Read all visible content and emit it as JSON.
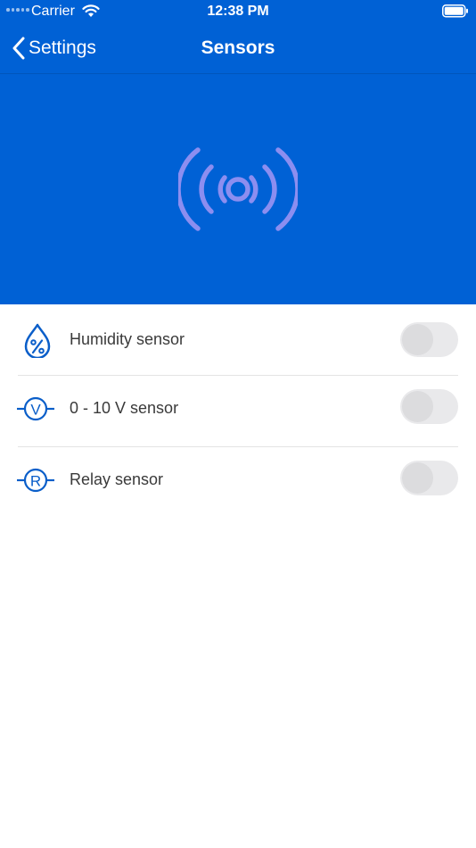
{
  "status_bar": {
    "carrier": "Carrier",
    "time": "12:38 PM"
  },
  "nav": {
    "back_label": "Settings",
    "title": "Sensors"
  },
  "icons": {
    "hero": "broadcast-signal-icon",
    "back": "chevron-left-icon"
  },
  "sensors": [
    {
      "label": "Humidity sensor",
      "icon": "humidity-drop-icon",
      "enabled": false
    },
    {
      "label": "0 - 10 V sensor",
      "icon": "voltage-v-icon",
      "enabled": false
    },
    {
      "label": "Relay sensor",
      "icon": "relay-r-icon",
      "enabled": false
    }
  ],
  "colors": {
    "brand_blue": "#0061d5",
    "hero_icon": "#8c8ef0",
    "row_icon": "#0a5ec9",
    "toggle_off": "#e9e9eb"
  }
}
